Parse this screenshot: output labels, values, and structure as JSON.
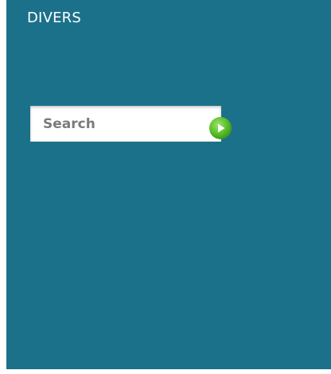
{
  "widget": {
    "title": "DIVERS"
  },
  "search": {
    "placeholder": "Search",
    "go_icon": "play-arrow-icon",
    "go_color": "#5cc22a"
  },
  "colors": {
    "panel_background": "#1b7189",
    "title_text": "#ffffff",
    "placeholder_text": "#7a7a7a"
  }
}
